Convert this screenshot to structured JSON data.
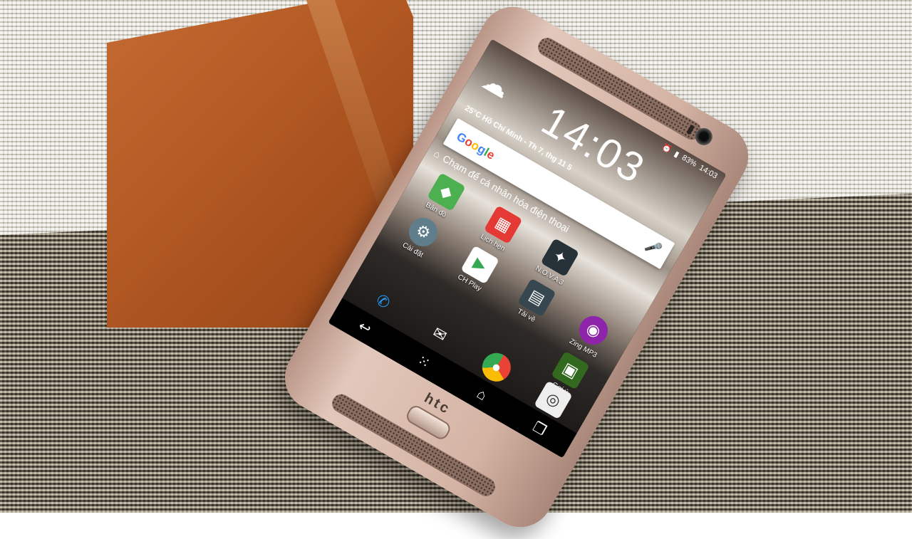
{
  "scene": {
    "wallet_color": "#b45a24",
    "phone_color": "#d8b8a9",
    "brand": "htc"
  },
  "status_bar": {
    "battery": "83%",
    "time": "14:03"
  },
  "lock_widget": {
    "weather_icon": "rain-cloud-icon",
    "clock": "14:03",
    "weather_line": "25°C Hồ Chí Minh - Th 7, thg 11 5"
  },
  "search": {
    "logo_parts": [
      "G",
      "o",
      "o",
      "g",
      "l",
      "e"
    ],
    "placeholder": ""
  },
  "personalize_text": "Chạm để cá nhân hóa điện thoại",
  "apps": [
    {
      "label": "Bản đồ",
      "icon": "maps-icon",
      "color": "#4caf50"
    },
    {
      "label": "Lịch hẹn",
      "icon": "calendar-icon",
      "color": "#e53935"
    },
    {
      "label": "N.O.V.A 3",
      "icon": "nova-game-icon",
      "color": "#263238"
    },
    {
      "label": "",
      "icon": "",
      "color": ""
    },
    {
      "label": "Cài đặt",
      "icon": "settings-icon",
      "color": "#607d8b"
    },
    {
      "label": "CH Play",
      "icon": "play-store-icon",
      "color": "#ffffff"
    },
    {
      "label": "Tải về",
      "icon": "downloads-folder-icon",
      "color": "#37474f"
    },
    {
      "label": "Zing MP3",
      "icon": "zing-mp3-icon",
      "color": "#8e24aa"
    },
    {
      "label": "",
      "icon": "",
      "color": ""
    },
    {
      "label": "",
      "icon": "",
      "color": ""
    },
    {
      "label": "",
      "icon": "",
      "color": ""
    },
    {
      "label": "Gợi ý",
      "icon": "suggestions-folder-icon",
      "color": "#33691e"
    }
  ],
  "dock": [
    {
      "icon": "phone-icon"
    },
    {
      "icon": "messages-icon"
    },
    {
      "icon": "chrome-icon"
    },
    {
      "icon": "camera-icon"
    }
  ],
  "nav": {
    "back": "back-icon",
    "apps": "app-drawer-icon",
    "home": "home-icon",
    "recents": "recents-icon"
  }
}
